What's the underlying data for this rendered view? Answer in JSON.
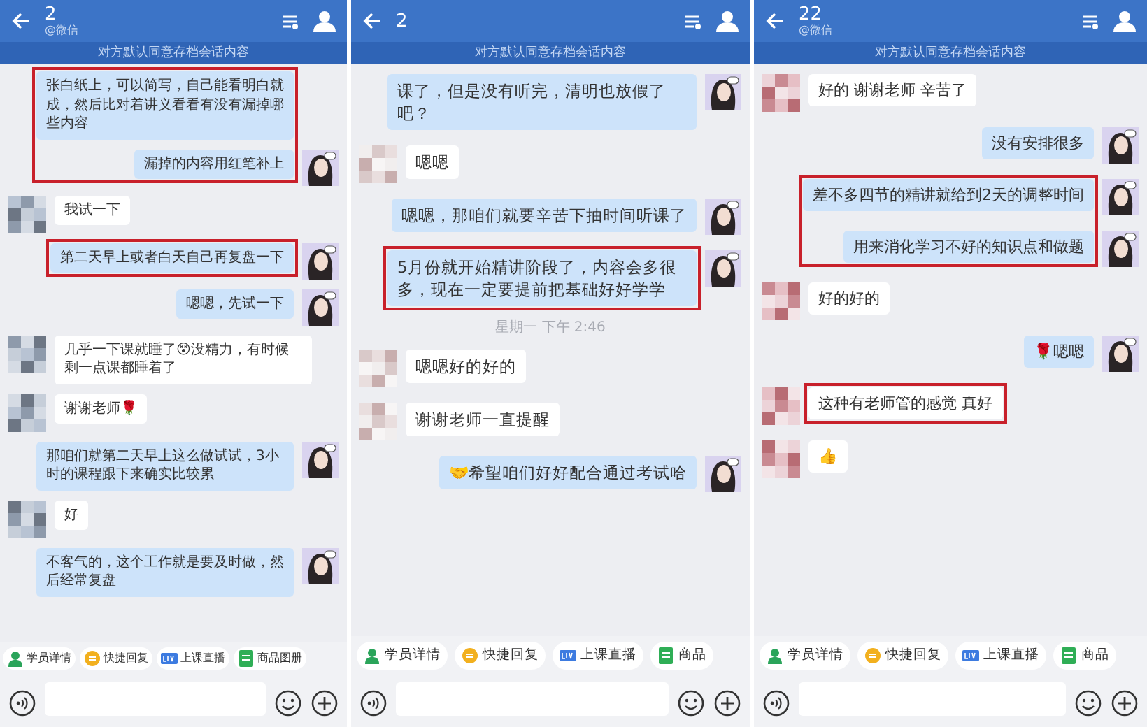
{
  "panels": [
    {
      "title": "2",
      "subtitle": "@微信",
      "notice": "对方默认同意存档会话内容",
      "messages": [
        {
          "kind": "out",
          "text": "张白纸上，可以简写，自己能看明白就成，然后比对着讲义看看有没有漏掉哪些内容",
          "avatar": false,
          "boxed": true
        },
        {
          "kind": "out",
          "text": "漏掉的内容用红笔补上",
          "avatar": true,
          "boxed": true
        },
        {
          "kind": "in",
          "text": "我试一下",
          "avatar": true,
          "boxed": false
        },
        {
          "kind": "out",
          "text": "第二天早上或者白天自己再复盘一下",
          "avatar": true,
          "boxed": true
        },
        {
          "kind": "out",
          "text": "嗯嗯，先试一下",
          "avatar": true,
          "boxed": false
        },
        {
          "kind": "in",
          "text": "几乎一下课就睡了😵没精力，有时候剩一点课都睡着了",
          "avatar": true,
          "boxed": false
        },
        {
          "kind": "in",
          "text": "谢谢老师🌹",
          "avatar": true,
          "boxed": false
        },
        {
          "kind": "out",
          "text": "那咱们就第二天早上这么做试试，3小时的课程跟下来确实比较累",
          "avatar": true,
          "boxed": false
        },
        {
          "kind": "in",
          "text": "好",
          "avatar": true,
          "boxed": false
        },
        {
          "kind": "out",
          "text": "不客气的，这个工作就是要及时做，然后经常复盘",
          "avatar": true,
          "boxed": false
        }
      ],
      "shortcuts": [
        "学员详情",
        "快捷回复",
        "上课直播",
        "商品图册"
      ]
    },
    {
      "title": "2",
      "notice": "对方默认同意存档会话内容",
      "messages": [
        {
          "kind": "out",
          "text": "课了，但是没有听完，清明也放假了吧？",
          "avatar": true,
          "boxed": false
        },
        {
          "kind": "in",
          "text": "嗯嗯",
          "avatar": true,
          "boxed": false
        },
        {
          "kind": "out",
          "text": "嗯嗯，那咱们就要辛苦下抽时间听课了",
          "avatar": true,
          "boxed": false
        },
        {
          "kind": "out",
          "text": "5月份就开始精讲阶段了，内容会多很多，现在一定要提前把基础好好学学",
          "avatar": true,
          "boxed": true
        },
        {
          "kind": "time",
          "text": "星期一 下午 2:46"
        },
        {
          "kind": "in",
          "text": "嗯嗯好的好的",
          "avatar": true,
          "boxed": false
        },
        {
          "kind": "in",
          "text": "谢谢老师一直提醒",
          "avatar": true,
          "boxed": false
        },
        {
          "kind": "out",
          "text": "🤝希望咱们好好配合通过考试哈",
          "avatar": true,
          "boxed": false
        }
      ],
      "shortcuts": [
        "学员详情",
        "快捷回复",
        "上课直播",
        "商品"
      ]
    },
    {
      "title": "22",
      "subtitle": "@微信",
      "notice": "对方默认同意存档会话内容",
      "messages": [
        {
          "kind": "in",
          "text": "好的 谢谢老师 辛苦了",
          "avatar": true,
          "boxed": false
        },
        {
          "kind": "out",
          "text": "没有安排很多",
          "avatar": true,
          "boxed": false
        },
        {
          "kind": "out",
          "text": "差不多四节的精讲就给到2天的调整时间",
          "avatar": true,
          "boxed": true
        },
        {
          "kind": "out",
          "text": "用来消化学习不好的知识点和做题",
          "avatar": true,
          "boxed": true
        },
        {
          "kind": "in",
          "text": "好的好的",
          "avatar": true,
          "boxed": false
        },
        {
          "kind": "out",
          "text": "🌹嗯嗯",
          "avatar": true,
          "boxed": false
        },
        {
          "kind": "in",
          "text": "这种有老师管的感觉 真好",
          "avatar": true,
          "boxed": true
        },
        {
          "kind": "in",
          "text": "👍",
          "avatar": true,
          "boxed": false
        }
      ],
      "shortcuts": [
        "学员详情",
        "快捷回复",
        "上课直播",
        "商品"
      ]
    }
  ]
}
